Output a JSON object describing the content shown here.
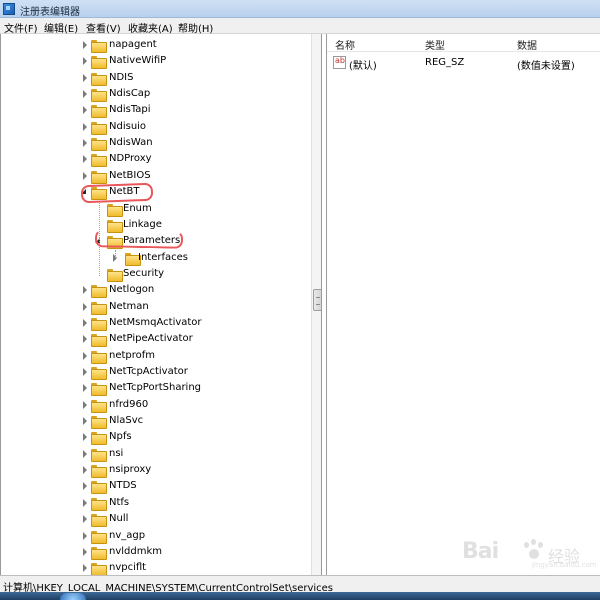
{
  "window": {
    "title": "注册表编辑器"
  },
  "menu": {
    "items": [
      {
        "label": "文件(F)"
      },
      {
        "label": "编辑(E)"
      },
      {
        "label": "查看(V)"
      },
      {
        "label": "收藏夹(A)"
      },
      {
        "label": "帮助(H)"
      }
    ]
  },
  "tree": {
    "items": [
      {
        "label": "napagent",
        "level": 0,
        "state": "collapsed"
      },
      {
        "label": "NativeWifiP",
        "level": 0,
        "state": "collapsed"
      },
      {
        "label": "NDIS",
        "level": 0,
        "state": "collapsed"
      },
      {
        "label": "NdisCap",
        "level": 0,
        "state": "collapsed"
      },
      {
        "label": "NdisTapi",
        "level": 0,
        "state": "collapsed"
      },
      {
        "label": "Ndisuio",
        "level": 0,
        "state": "collapsed"
      },
      {
        "label": "NdisWan",
        "level": 0,
        "state": "collapsed"
      },
      {
        "label": "NDProxy",
        "level": 0,
        "state": "collapsed"
      },
      {
        "label": "NetBIOS",
        "level": 0,
        "state": "collapsed"
      },
      {
        "label": "NetBT",
        "level": 0,
        "state": "expanded"
      },
      {
        "label": "Enum",
        "level": 1,
        "state": "none"
      },
      {
        "label": "Linkage",
        "level": 1,
        "state": "none"
      },
      {
        "label": "Parameters",
        "level": 1,
        "state": "expanded"
      },
      {
        "label": "Interfaces",
        "level": 2,
        "state": "collapsed"
      },
      {
        "label": "Security",
        "level": 1,
        "state": "none"
      },
      {
        "label": "Netlogon",
        "level": 0,
        "state": "collapsed"
      },
      {
        "label": "Netman",
        "level": 0,
        "state": "collapsed"
      },
      {
        "label": "NetMsmqActivator",
        "level": 0,
        "state": "collapsed"
      },
      {
        "label": "NetPipeActivator",
        "level": 0,
        "state": "collapsed"
      },
      {
        "label": "netprofm",
        "level": 0,
        "state": "collapsed"
      },
      {
        "label": "NetTcpActivator",
        "level": 0,
        "state": "collapsed"
      },
      {
        "label": "NetTcpPortSharing",
        "level": 0,
        "state": "collapsed"
      },
      {
        "label": "nfrd960",
        "level": 0,
        "state": "collapsed"
      },
      {
        "label": "NlaSvc",
        "level": 0,
        "state": "collapsed"
      },
      {
        "label": "Npfs",
        "level": 0,
        "state": "collapsed"
      },
      {
        "label": "nsi",
        "level": 0,
        "state": "collapsed"
      },
      {
        "label": "nsiproxy",
        "level": 0,
        "state": "collapsed"
      },
      {
        "label": "NTDS",
        "level": 0,
        "state": "collapsed"
      },
      {
        "label": "Ntfs",
        "level": 0,
        "state": "collapsed"
      },
      {
        "label": "Null",
        "level": 0,
        "state": "collapsed"
      },
      {
        "label": "nv_agp",
        "level": 0,
        "state": "collapsed"
      },
      {
        "label": "nvlddmkm",
        "level": 0,
        "state": "collapsed"
      },
      {
        "label": "nvpciflt",
        "level": 0,
        "state": "collapsed"
      }
    ]
  },
  "values": {
    "columns": [
      "名称",
      "类型",
      "数据"
    ],
    "rows": [
      {
        "name": "(默认)",
        "type": "REG_SZ",
        "data": "(数值未设置)",
        "icon": "string-value-icon"
      }
    ]
  },
  "status": {
    "path": "计算机\\HKEY_LOCAL_MACHINE\\SYSTEM\\CurrentControlSet\\services"
  },
  "watermark": {
    "text": "Bai",
    "cn": "经验",
    "sub": "jingyan.baidu.com"
  },
  "colors": {
    "annotation": "#e8585a",
    "folder": "#f0bb2c",
    "title_bar": "#b9d1ee"
  }
}
